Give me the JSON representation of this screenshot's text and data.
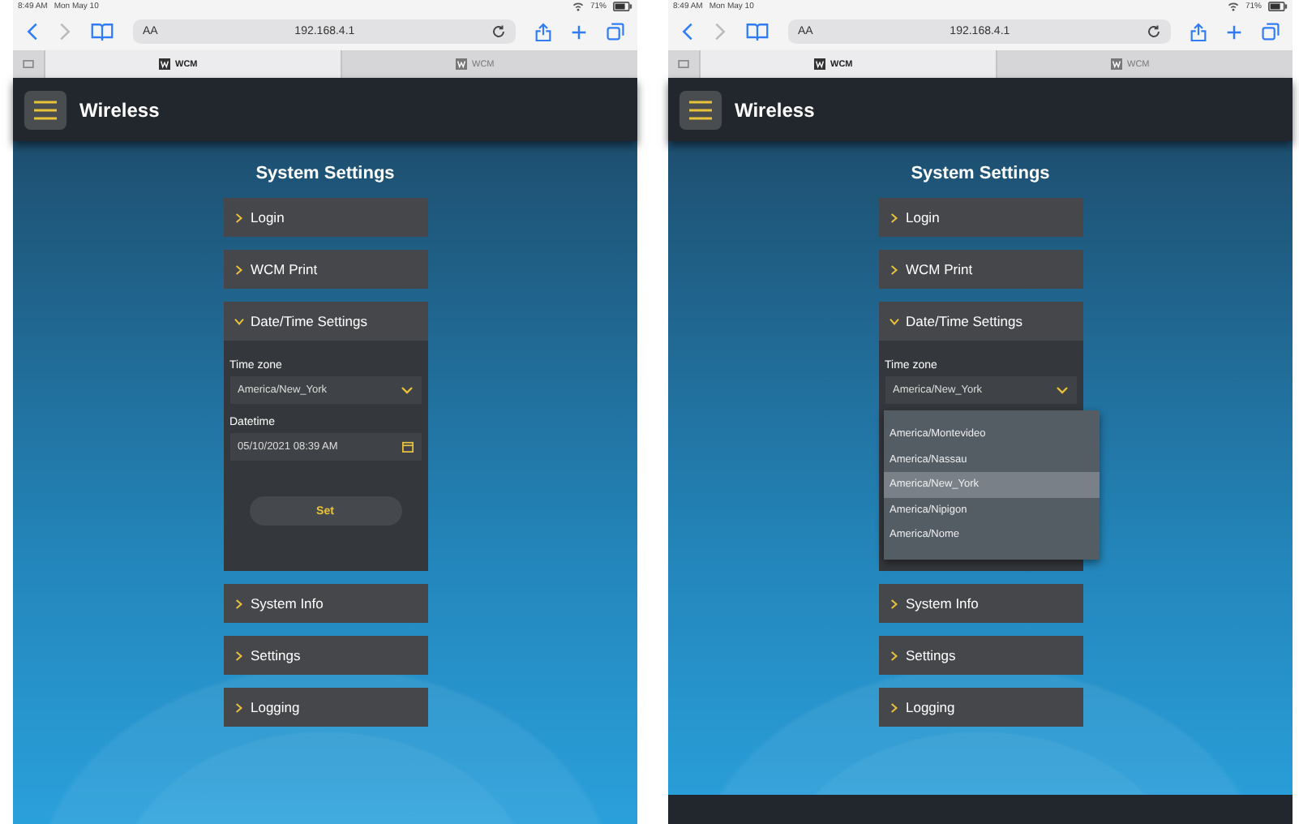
{
  "screens": [
    {
      "status": {
        "time": "8:49 AM",
        "date": "Mon May 10",
        "battery": "71%"
      },
      "text_size": "AA",
      "address": "192.168.4.1",
      "tabs": [
        {
          "label": "WCM",
          "selected": true
        },
        {
          "label": "WCM",
          "selected": false
        }
      ],
      "logo": "Wireless",
      "title": "System Settings",
      "sections": [
        {
          "label": "Login",
          "expanded": false
        },
        {
          "label": "WCM Print",
          "expanded": false
        },
        {
          "label": "Date/Time Settings",
          "expanded": true,
          "timezone_label": "Time zone",
          "timezone": "America/New_York",
          "datetime_label": "Datetime",
          "datetime": "05/10/2021 08:39 AM",
          "set_button": "Set"
        },
        {
          "label": "System Info",
          "expanded": false
        },
        {
          "label": "Settings",
          "expanded": false
        },
        {
          "label": "Logging",
          "expanded": false
        }
      ],
      "bottom_bar": false
    },
    {
      "status": {
        "time": "8:49 AM",
        "date": "Mon May 10",
        "battery": "71%"
      },
      "text_size": "AA",
      "address": "192.168.4.1",
      "tabs": [
        {
          "label": "WCM",
          "selected": true
        },
        {
          "label": "WCM",
          "selected": false
        }
      ],
      "logo": "Wireless",
      "title": "System Settings",
      "sections": [
        {
          "label": "Login",
          "expanded": false
        },
        {
          "label": "WCM Print",
          "expanded": false
        },
        {
          "label": "Date/Time Settings",
          "expanded": true,
          "timezone_label": "Time zone",
          "timezone": "America/New_York",
          "options": [
            {
              "label": "America/Montevideo",
              "selected": false
            },
            {
              "label": "America/Nassau",
              "selected": false
            },
            {
              "label": "America/New_York",
              "selected": true
            },
            {
              "label": "America/Nipigon",
              "selected": false
            },
            {
              "label": "America/Nome",
              "selected": false
            }
          ]
        },
        {
          "label": "System Info",
          "expanded": false
        },
        {
          "label": "Settings",
          "expanded": false
        },
        {
          "label": "Logging",
          "expanded": false
        }
      ],
      "bottom_bar": true
    }
  ]
}
